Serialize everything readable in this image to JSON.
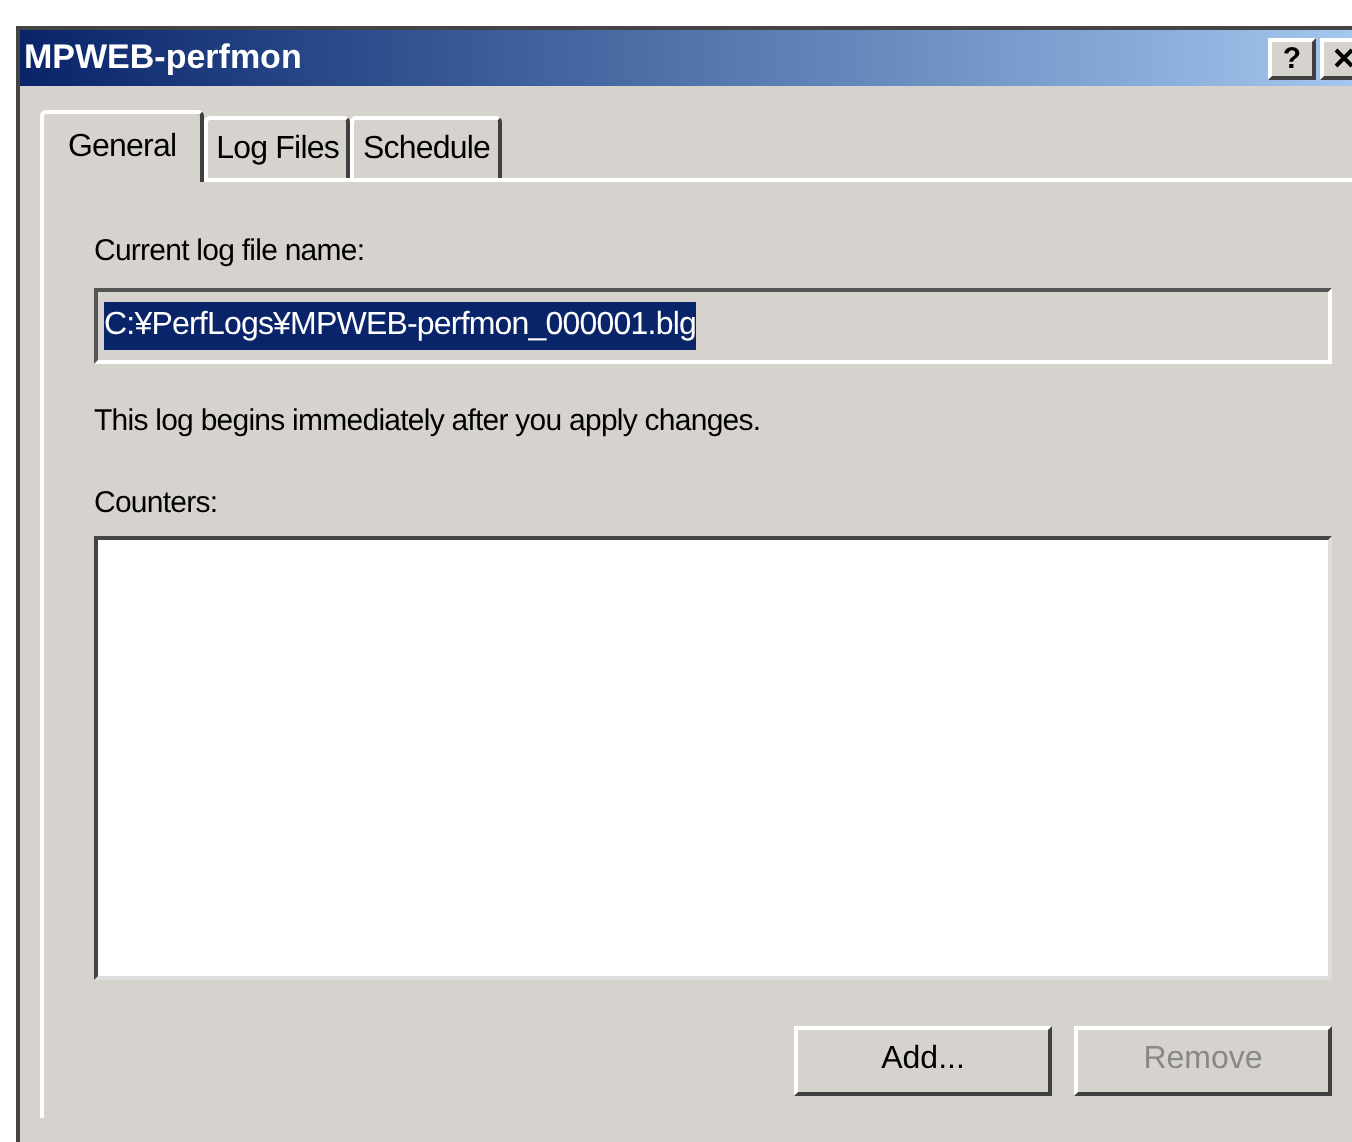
{
  "window": {
    "title": "MPWEB-perfmon",
    "help_button": "?"
  },
  "tabs": [
    {
      "label": "General",
      "selected": true
    },
    {
      "label": "Log Files",
      "selected": false
    },
    {
      "label": "Schedule",
      "selected": false
    }
  ],
  "current_log_file": {
    "label": "Current log file name:",
    "value": "C:¥PerfLogs¥MPWEB-perfmon_000001.blg",
    "selected": true
  },
  "status_text": "This log begins immediately after you apply changes.",
  "counters": {
    "label": "Counters:"
  },
  "buttons": [
    {
      "label": "Add...",
      "disabled": false
    },
    {
      "label": "Remove",
      "disabled": true
    }
  ]
}
